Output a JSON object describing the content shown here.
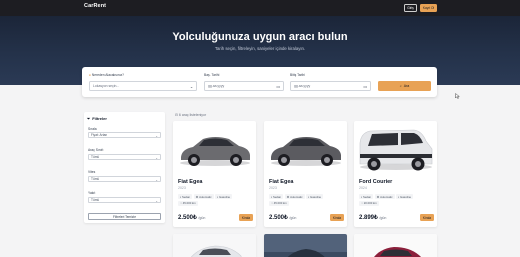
{
  "nav": {
    "brand": "CarRent",
    "login_label": "Giriş",
    "register_label": "Kayıt Ol"
  },
  "hero": {
    "title": "Yolculuğunuza uygun aracı bulun",
    "subtitle": "Tarih seçin, filtreleyin, saniyeler içinde kiralayın."
  },
  "search": {
    "location_label": "Nereden Alacaksınız?",
    "location_value": "Lokasyon seçin...",
    "start_label": "Baş. Tarihi",
    "start_placeholder": "gg.aa.yyyy",
    "end_label": "Bitiş Tarihi",
    "end_placeholder": "gg.aa.yyyy",
    "button_label": "Ara"
  },
  "filters": {
    "title": "Filtreler",
    "sort_label": "Sırala",
    "sort_value": "Fiyat: Artan",
    "type_label": "Araç Sınıfı",
    "type_value": "Tümü",
    "gear_label": "Vites",
    "gear_value": "Tümü",
    "fuel_label": "Yakıt",
    "fuel_value": "Tümü",
    "clear_label": "Filtreleri Temizle"
  },
  "results": {
    "count_text": "6 araç listeleniyor"
  },
  "cars": [
    {
      "name": "Fiat Egea",
      "year": "2023",
      "tags": [
        "Sedan",
        "Automatic",
        "Gasoline",
        "45.000 km"
      ],
      "price": "2.500₺",
      "per_day": "/gün",
      "button": "Kirala",
      "body_color": "#6b6b6f"
    },
    {
      "name": "Fiat Egea",
      "year": "2023",
      "tags": [
        "Sedan",
        "Automatic",
        "Gasoline",
        "45.000 km"
      ],
      "price": "2.500₺",
      "per_day": "/gün",
      "button": "Kirala",
      "body_color": "#5b5b60"
    },
    {
      "name": "Ford Courier",
      "year": "2024",
      "tags": [
        "Sedan",
        "Automatic",
        "Gasoline",
        "20.000 km"
      ],
      "price": "2.899₺",
      "per_day": "/gün",
      "button": "Kirala",
      "body_color": "#e6e7ea"
    }
  ],
  "colors": {
    "accent": "#e8a255",
    "nav_bg": "#1d1d22",
    "hero_bg": "#24324a"
  }
}
